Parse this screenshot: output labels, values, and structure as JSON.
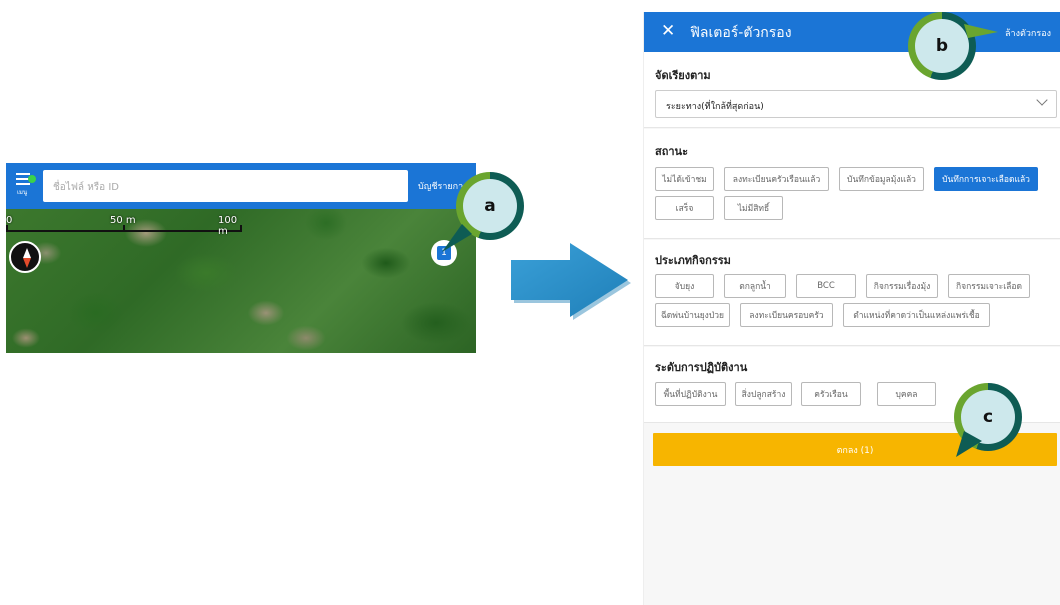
{
  "map_app": {
    "menu_label": "เมนู",
    "search_placeholder": "ชื่อไฟล์ หรือ ID",
    "account_label": "บัญชีรายการ",
    "scale": {
      "zero": "0",
      "mid": "50 m",
      "end": "100 m"
    },
    "badge_count": "1"
  },
  "callouts": {
    "a": "a",
    "b": "b",
    "c": "c"
  },
  "filter": {
    "close_symbol": "✕",
    "title": "ฟิลเตอร์-ตัวกรอง",
    "clear_label": "ล้างตัวกรอง",
    "sort": {
      "heading": "จัดเรียงตาม",
      "selected": "ระยะทาง(ที่ใกล้ที่สุดก่อน)"
    },
    "status": {
      "heading": "สถานะ",
      "chips": [
        {
          "label": "ไม่ได้เข้าชม",
          "active": false
        },
        {
          "label": "ลงทะเบียนครัวเรือนแล้ว",
          "active": false
        },
        {
          "label": "บันทึกข้อมูลมุ้งแล้ว",
          "active": false
        },
        {
          "label": "บันทึกการเจาะเลือดแล้ว",
          "active": true
        },
        {
          "label": "เสร็จ",
          "active": false
        },
        {
          "label": "ไม่มีสิทธิ์",
          "active": false
        }
      ]
    },
    "activity": {
      "heading": "ประเภทกิจกรรม",
      "chips": [
        {
          "label": "จับยุง"
        },
        {
          "label": "ตกลูกน้ำ"
        },
        {
          "label": "BCC"
        },
        {
          "label": "กิจกรรมเรื่องมุ้ง"
        },
        {
          "label": "กิจกรรมเจาะเลือด"
        },
        {
          "label": "ฉีดพ่นบ้านยุงป่วย"
        },
        {
          "label": "ลงทะเบียนครอบครัว"
        },
        {
          "label": "ตำแหน่งที่คาดว่าเป็นแหล่งแพร่เชื้อ"
        }
      ]
    },
    "level": {
      "heading": "ระดับการปฏิบัติงาน",
      "chips": [
        {
          "label": "พื้นที่ปฏิบัติงาน"
        },
        {
          "label": "สิ่งปลูกสร้าง"
        },
        {
          "label": "ครัวเรือน"
        },
        {
          "label": "บุคคล"
        }
      ]
    },
    "ok_label": "ตกลง (1)"
  },
  "colors": {
    "primary_blue": "#1b75d6",
    "ok_orange": "#f7b500",
    "callout_dark": "#0e5c54",
    "callout_green": "#6aa52f",
    "callout_fill": "#cde8ec"
  }
}
